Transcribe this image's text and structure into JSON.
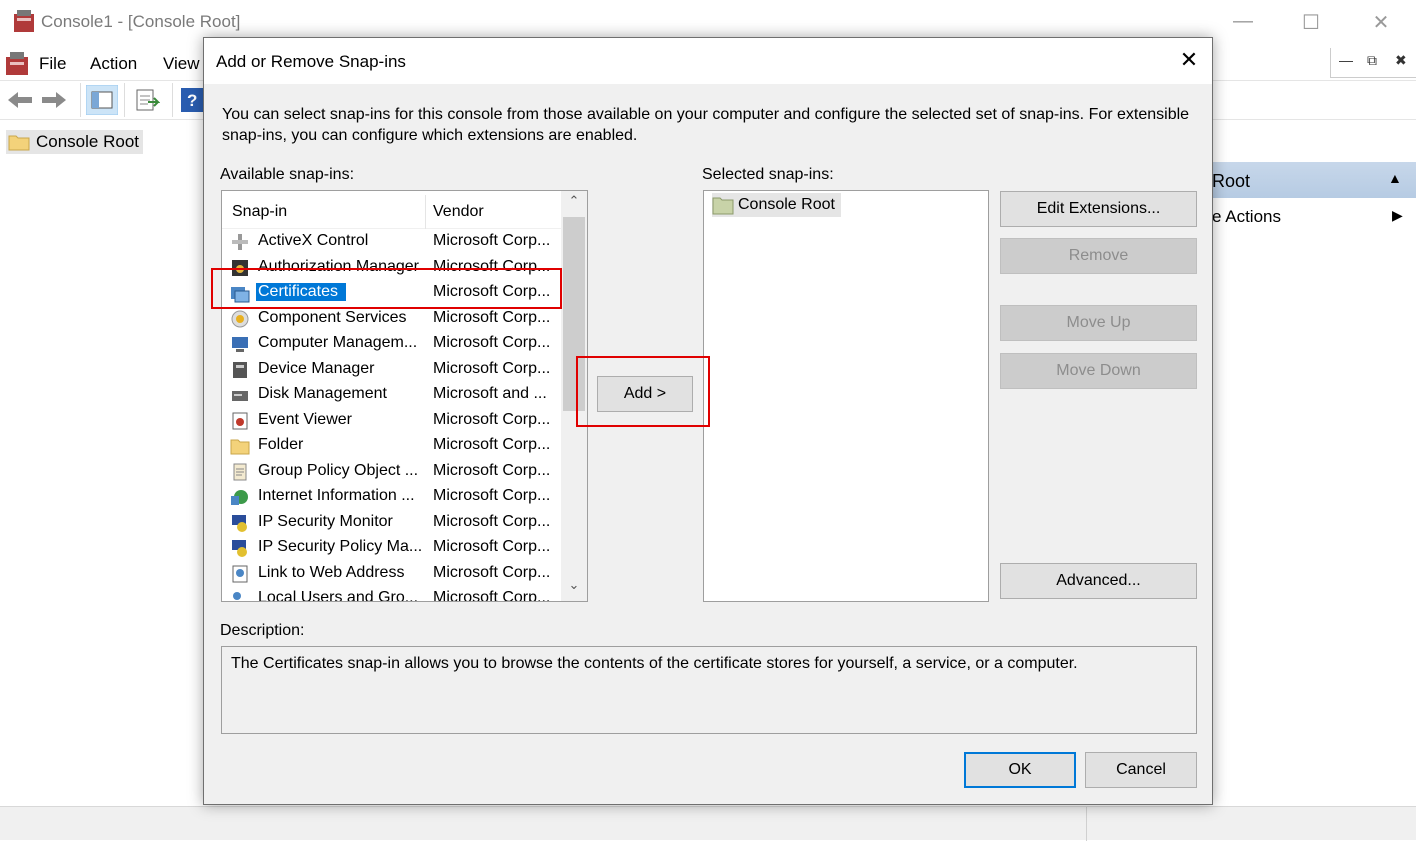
{
  "mmc": {
    "title": "Console1 - [Console Root]",
    "menu": [
      "File",
      "Action",
      "View"
    ],
    "tree_root": "Console Root",
    "actions_header": "Root",
    "actions_item": "e Actions"
  },
  "dialog": {
    "title": "Add or Remove Snap-ins",
    "intro": "You can select snap-ins for this console from those available on your computer and configure the selected set of snap-ins. For extensible snap-ins, you can configure which extensions are enabled.",
    "available_label": "Available snap-ins:",
    "selected_label": "Selected snap-ins:",
    "columns": {
      "snapin": "Snap-in",
      "vendor": "Vendor"
    },
    "available": [
      {
        "name": "ActiveX Control",
        "vendor": "Microsoft Corp...",
        "icon": "activex-icon"
      },
      {
        "name": "Authorization Manager",
        "vendor": "Microsoft Corp...",
        "icon": "authorization-icon"
      },
      {
        "name": "Certificates",
        "vendor": "Microsoft Corp...",
        "icon": "certificates-icon",
        "selected": true
      },
      {
        "name": "Component Services",
        "vendor": "Microsoft Corp...",
        "icon": "component-services-icon"
      },
      {
        "name": "Computer Managem...",
        "vendor": "Microsoft Corp...",
        "icon": "computer-management-icon"
      },
      {
        "name": "Device Manager",
        "vendor": "Microsoft Corp...",
        "icon": "device-manager-icon"
      },
      {
        "name": "Disk Management",
        "vendor": "Microsoft and ...",
        "icon": "disk-management-icon"
      },
      {
        "name": "Event Viewer",
        "vendor": "Microsoft Corp...",
        "icon": "event-viewer-icon"
      },
      {
        "name": "Folder",
        "vendor": "Microsoft Corp...",
        "icon": "folder-icon"
      },
      {
        "name": "Group Policy Object ...",
        "vendor": "Microsoft Corp...",
        "icon": "group-policy-icon"
      },
      {
        "name": "Internet Information ...",
        "vendor": "Microsoft Corp...",
        "icon": "iis-icon"
      },
      {
        "name": "IP Security Monitor",
        "vendor": "Microsoft Corp...",
        "icon": "ip-security-monitor-icon"
      },
      {
        "name": "IP Security Policy Ma...",
        "vendor": "Microsoft Corp...",
        "icon": "ip-security-policy-icon"
      },
      {
        "name": "Link to Web Address",
        "vendor": "Microsoft Corp...",
        "icon": "web-link-icon"
      },
      {
        "name": "Local Users and Gro...",
        "vendor": "Microsoft Corp...",
        "icon": "local-users-icon"
      }
    ],
    "selected": [
      {
        "name": "Console Root",
        "icon": "folder-icon"
      }
    ],
    "buttons": {
      "add": "Add >",
      "edit_extensions": "Edit Extensions...",
      "remove": "Remove",
      "move_up": "Move Up",
      "move_down": "Move Down",
      "advanced": "Advanced...",
      "ok": "OK",
      "cancel": "Cancel"
    },
    "description_label": "Description:",
    "description": "The Certificates snap-in allows you to browse the contents of the certificate stores for yourself, a service, or a computer."
  },
  "colors": {
    "selection": "#0078d7",
    "highlight": "#e00000",
    "dialog_bg": "#f0f0f0"
  }
}
